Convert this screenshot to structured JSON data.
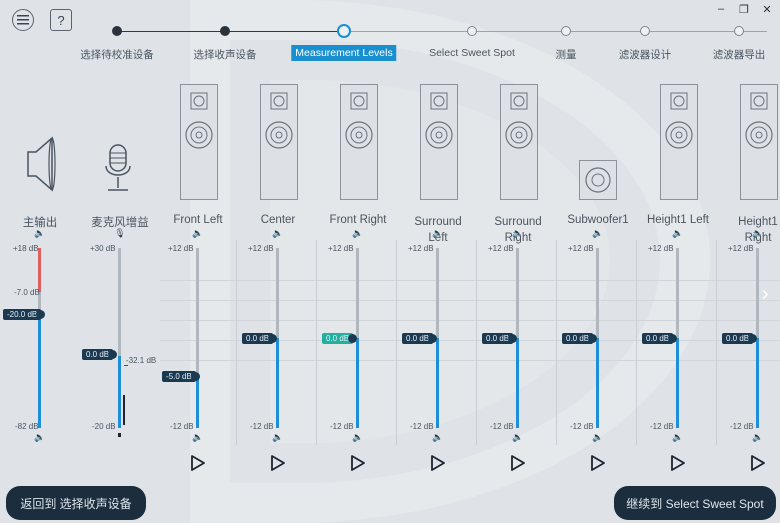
{
  "topbar": {
    "help_label": "?",
    "minimize": "–",
    "restore": "❐",
    "close": "✕"
  },
  "steps": [
    {
      "label": "选择待校准设备",
      "state": "done"
    },
    {
      "label": "选择收声设备",
      "state": "done"
    },
    {
      "label": "Measurement Levels",
      "state": "active"
    },
    {
      "label": "Select Sweet Spot",
      "state": "pending"
    },
    {
      "label": "测量",
      "state": "pending"
    },
    {
      "label": "滤波器设计",
      "state": "pending"
    },
    {
      "label": "滤波器导出",
      "state": "pending"
    }
  ],
  "main_output": {
    "label": "主输出",
    "scale_top": "+18 dB",
    "mark": "-7.0 dB",
    "value": "-20.0 dB",
    "value_db": -20.0,
    "scale_bottom": "-82 dB"
  },
  "mic_gain": {
    "label": "麦克风增益",
    "scale_top": "+30 dB",
    "value": "0.0 dB",
    "value_db": 0.0,
    "reading": "-32.1 dB",
    "scale_bottom": "-20 dB"
  },
  "channels": [
    {
      "label": "Front Left",
      "scale_top": "+12 dB",
      "scale_bottom": "-12 dB",
      "value": "-5.0 dB",
      "value_db": -5.0,
      "highlight": false,
      "tall": true
    },
    {
      "label": "Center",
      "scale_top": "+12 dB",
      "scale_bottom": "-12 dB",
      "value": "0.0 dB",
      "value_db": 0.0,
      "highlight": false,
      "tall": true
    },
    {
      "label": "Front Right",
      "scale_top": "+12 dB",
      "scale_bottom": "-12 dB",
      "value": "0.0 dB",
      "value_db": 0.0,
      "highlight": true,
      "tall": true
    },
    {
      "label": "Surround Left",
      "scale_top": "+12 dB",
      "scale_bottom": "-12 dB",
      "value": "0.0 dB",
      "value_db": 0.0,
      "highlight": false,
      "tall": true
    },
    {
      "label": "Surround Right",
      "scale_top": "+12 dB",
      "scale_bottom": "-12 dB",
      "value": "0.0 dB",
      "value_db": 0.0,
      "highlight": false,
      "tall": true
    },
    {
      "label": "Subwoofer1",
      "scale_top": "+12 dB",
      "scale_bottom": "-12 dB",
      "value": "0.0 dB",
      "value_db": 0.0,
      "highlight": false,
      "tall": false
    },
    {
      "label": "Height1 Left",
      "scale_top": "+12 dB",
      "scale_bottom": "-12 dB",
      "value": "0.0 dB",
      "value_db": 0.0,
      "highlight": false,
      "tall": true
    },
    {
      "label": "Height1 Right",
      "scale_top": "+12 dB",
      "scale_bottom": "-12 dB",
      "value": "0.0 dB",
      "value_db": 0.0,
      "highlight": false,
      "tall": true
    }
  ],
  "bottom": {
    "back_label": "返回到 选择收声设备",
    "next_label": "继续到 Select Sweet Spot"
  },
  "colors": {
    "accent": "#1a8fd0",
    "fill_blue": "#1c8fd8",
    "clip_red": "#e06060",
    "thumb_dark": "#1b3a52",
    "thumb_highlight": "#23b0a0",
    "button_dark": "#1c2e3e"
  }
}
